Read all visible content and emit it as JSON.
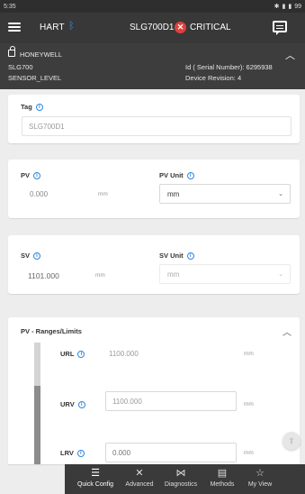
{
  "status_bar": {
    "time": "5:35",
    "indicators": "99"
  },
  "app_bar": {
    "protocol": "HART",
    "device_tag": "SLG700D1",
    "status_label": "CRITICAL",
    "status_color": "#e0403c",
    "icons": [
      "hamburger-menu",
      "bluetooth",
      "critical-status",
      "chat"
    ]
  },
  "device_header": {
    "manufacturer": "HONEYWELL",
    "model": "SLG700",
    "serial_label": "Id ( Serial Number): 6295938",
    "device_type": "SENSOR_LEVEL",
    "revision_label": "Device Revision: 4"
  },
  "tag_card": {
    "label": "Tag",
    "value": "SLG700D1"
  },
  "pv_card": {
    "label": "PV",
    "value": "0.000",
    "unit_suffix": "mm",
    "unit_label": "PV Unit",
    "unit_value": "mm"
  },
  "sv_card": {
    "label": "SV",
    "value": "1101.000",
    "unit_suffix": "mm",
    "unit_label": "SV Unit",
    "unit_value": "mm"
  },
  "ranges_card": {
    "title": "PV - Ranges/Limits",
    "rows": [
      {
        "label": "URL",
        "value": "1100.000",
        "unit": "mm"
      },
      {
        "label": "URV",
        "value": "1100.000",
        "unit": "mm"
      },
      {
        "label": "LRV",
        "value": "0.000",
        "unit": "mm"
      }
    ]
  },
  "bottom_nav": {
    "items": [
      {
        "label": "Quick Config",
        "active": true
      },
      {
        "label": "Advanced"
      },
      {
        "label": "Diagnostics"
      },
      {
        "label": "Methods"
      },
      {
        "label": "My View"
      }
    ]
  }
}
